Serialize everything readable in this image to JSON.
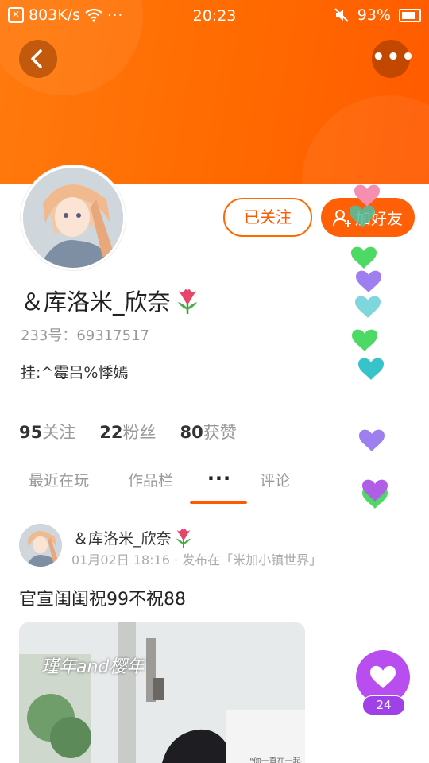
{
  "status_bar": {
    "speed": "803K/s",
    "time": "20:23",
    "battery": "93%"
  },
  "profile": {
    "name": "＆库洛米_欣奈",
    "uid": "233号：69317517",
    "signature": "挂:^霉吕%悸嫣",
    "follow_button": "已关注",
    "add_friend_button": "加好友",
    "stats": [
      {
        "value": "95",
        "label": "关注"
      },
      {
        "value": "22",
        "label": "粉丝"
      },
      {
        "value": "80",
        "label": "获赞"
      }
    ]
  },
  "tabs": {
    "recent": "最近在玩",
    "works": "作品栏",
    "active": "···",
    "comments": "评论"
  },
  "post": {
    "author": "＆库洛米_欣奈",
    "meta": "01月02日 18:16 · 发布在「米加小镇世界」",
    "text": "官宣闺闺祝99不祝88",
    "image_caption": "瑾年and樱年",
    "image_subcaption": "\"你一直在一起"
  },
  "like": {
    "count": "24"
  },
  "colors": {
    "accent": "#ff6a00",
    "like": "#b84ef0"
  },
  "icons": [
    "back-icon",
    "more-icon",
    "add-user-icon",
    "tulip-icon",
    "heart-icon"
  ]
}
